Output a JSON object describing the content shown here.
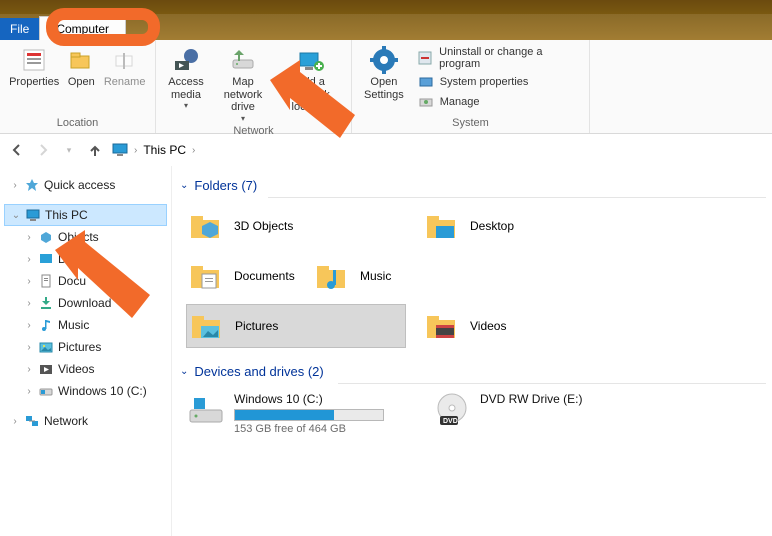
{
  "tabs": {
    "file": "File",
    "computer": "Computer"
  },
  "ribbon": {
    "location": {
      "label": "Location",
      "properties": "Properties",
      "open": "Open",
      "rename": "Rename"
    },
    "network": {
      "label": "Network",
      "access_media": "Access media",
      "map_drive": "Map network drive",
      "add_location": "Add a network location"
    },
    "system": {
      "label": "System",
      "open_settings": "Open Settings",
      "uninstall": "Uninstall or change a program",
      "sys_props": "System properties",
      "manage": "Manage"
    }
  },
  "breadcrumb": {
    "root": "This PC"
  },
  "sidebar": {
    "quick_access": "Quick access",
    "this_pc": "This PC",
    "objects3d": "Objects",
    "desktop": "D",
    "documents": "Docu",
    "downloads": "Download",
    "music": "Music",
    "pictures": "Pictures",
    "videos": "Videos",
    "win10": "Windows 10 (C:)",
    "network": "Network"
  },
  "sections": {
    "folders": "Folders (7)",
    "devices": "Devices and drives (2)"
  },
  "folders": {
    "objects3d": "3D Objects",
    "desktop": "Desktop",
    "documents": "Documents",
    "music": "Music",
    "pictures": "Pictures",
    "videos": "Videos"
  },
  "drives": {
    "c": {
      "name": "Windows 10 (C:)",
      "sub": "153 GB free of 464 GB",
      "fill_pct": 67
    },
    "e": {
      "name": "DVD RW Drive (E:)"
    }
  }
}
